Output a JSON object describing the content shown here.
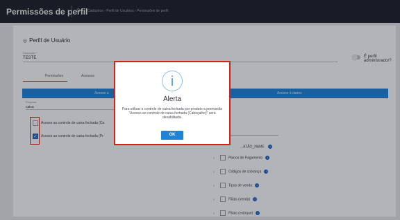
{
  "header": {
    "title": "Permissões de perfil",
    "breadcrumb": "Cadastros › Perfil de Usuários › Permissões de perfil"
  },
  "card": {
    "title": "Perfil de Usuário",
    "description": {
      "label": "Descrição *",
      "value": "TESTE"
    },
    "admin_toggle_label": "É perfil administrador?",
    "tabs": [
      "Permissões",
      "Acessos"
    ],
    "left_header": "Acesso a",
    "right_header": "Acesso à dados",
    "search": {
      "label": "Pesquisar",
      "value": "caixa"
    },
    "left_items": [
      {
        "label": "Acesso ao controle de caixa fechada (Ca",
        "checked": false
      },
      {
        "label": "Acesso ao controle de caixa fechada (Pr",
        "checked": true
      }
    ],
    "right_top": "...ATÃO_NAME",
    "right_items": [
      "Planos de Pagamento",
      "Códigos de cobrança",
      "Tipos de venda",
      "Filiais (venda)",
      "Filiais (estoque)"
    ]
  },
  "modal": {
    "title": "Alerta",
    "message": "Para utilizar o controle de caixa fechada por produto a permissão \"Acesso ao controle de caixa fechada (Cabeçalho)\" será desabilitada.",
    "ok_label": "OK"
  },
  "colors": {
    "topbar": "#1c1f2b",
    "accent": "#1f84d8",
    "highlight": "#d62020"
  }
}
